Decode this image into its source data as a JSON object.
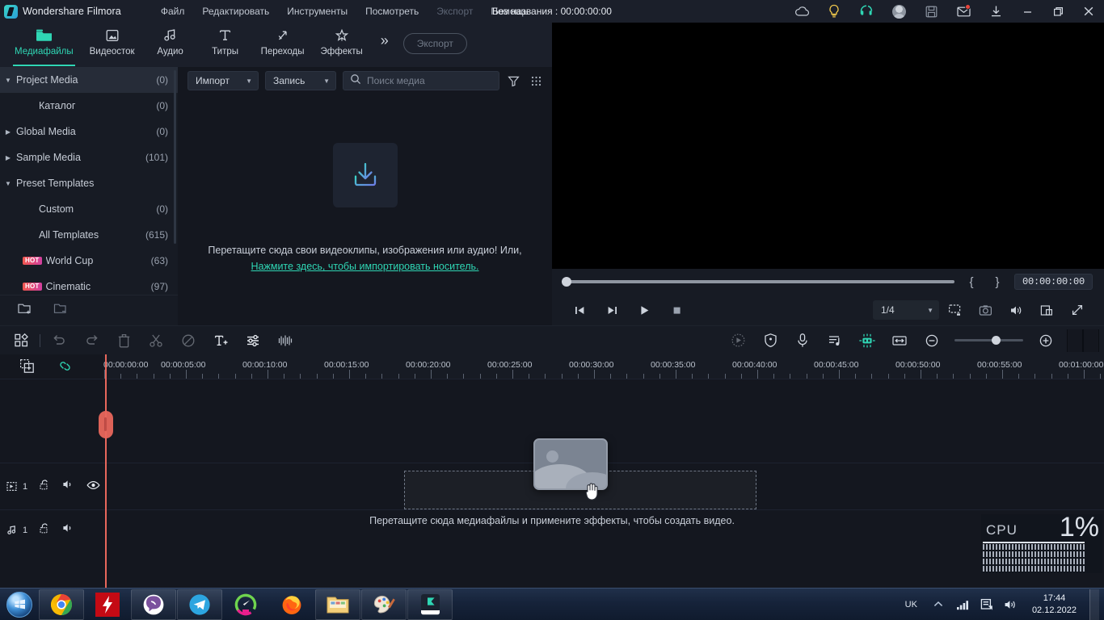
{
  "titlebar": {
    "app_name": "Wondershare Filmora",
    "logo_icon": "filmora-logo-icon",
    "menus": [
      {
        "label": "Файл",
        "dim": false
      },
      {
        "label": "Редактировать",
        "dim": false
      },
      {
        "label": "Инструменты",
        "dim": false
      },
      {
        "label": "Посмотреть",
        "dim": false
      },
      {
        "label": "Экспорт",
        "dim": true
      },
      {
        "label": "Помощь",
        "dim": false
      }
    ],
    "project_title": "Без названия : 00:00:00:00",
    "right_icons": [
      {
        "name": "cloud-icon"
      },
      {
        "name": "lightbulb-icon"
      },
      {
        "name": "headset-support-icon"
      },
      {
        "name": "account-avatar"
      },
      {
        "name": "save-icon"
      },
      {
        "name": "mail-icon",
        "badge": true
      },
      {
        "name": "download-icon"
      }
    ],
    "window_controls": [
      {
        "name": "minimize-button"
      },
      {
        "name": "maximize-button"
      },
      {
        "name": "close-button"
      }
    ]
  },
  "navtabs": {
    "items": [
      {
        "label": "Медиафайлы",
        "icon": "folder-media-icon",
        "active": true
      },
      {
        "label": "Видеосток",
        "icon": "stock-video-icon",
        "active": false
      },
      {
        "label": "Аудио",
        "icon": "audio-note-icon",
        "active": false
      },
      {
        "label": "Титры",
        "icon": "title-text-icon",
        "active": false
      },
      {
        "label": "Переходы",
        "icon": "transitions-icon",
        "active": false
      },
      {
        "label": "Эффекты",
        "icon": "effects-star-icon",
        "active": false
      }
    ],
    "more_icon": "chevron-double-right-icon",
    "export_label": "Экспорт"
  },
  "sidebar": {
    "items": [
      {
        "label": "Project Media",
        "count": "(0)",
        "indent": 0,
        "arrow": "down",
        "selected": true,
        "hot": false
      },
      {
        "label": "Каталог",
        "count": "(0)",
        "indent": 1,
        "arrow": "",
        "selected": false,
        "hot": false
      },
      {
        "label": "Global Media",
        "count": "(0)",
        "indent": 0,
        "arrow": "right",
        "selected": false,
        "hot": false
      },
      {
        "label": "Sample Media",
        "count": "(101)",
        "indent": 0,
        "arrow": "right",
        "selected": false,
        "hot": false
      },
      {
        "label": "Preset Templates",
        "count": "",
        "indent": 0,
        "arrow": "down",
        "selected": false,
        "hot": false
      },
      {
        "label": "Custom",
        "count": "(0)",
        "indent": 1,
        "arrow": "",
        "selected": false,
        "hot": false
      },
      {
        "label": "All Templates",
        "count": "(615)",
        "indent": 1,
        "arrow": "",
        "selected": false,
        "hot": false
      },
      {
        "label": "World Cup",
        "count": "(63)",
        "indent": 1,
        "arrow": "",
        "selected": false,
        "hot": true,
        "hot_label": "HOT"
      },
      {
        "label": "Cinematic",
        "count": "(97)",
        "indent": 1,
        "arrow": "",
        "selected": false,
        "hot": true,
        "hot_label": "HOT"
      }
    ],
    "footer_icons": [
      {
        "name": "add-folder-icon"
      },
      {
        "name": "remove-folder-icon"
      }
    ],
    "collapse_icon": "collapse-panel-icon"
  },
  "media": {
    "import_label": "Импорт",
    "record_label": "Запись",
    "search_placeholder": "Поиск медиа",
    "search_value": "",
    "search_icon": "search-icon",
    "filter_icon": "filter-icon",
    "grid_icon": "grid-view-icon",
    "drop_icon": "import-download-icon",
    "drop_text": "Перетащите сюда свои видеоклипы, изображения или аудио! Или,",
    "drop_link": "Нажмите здесь, чтобы импортировать носитель."
  },
  "player": {
    "timecode": "00:00:00:00",
    "mark_in_icon": "mark-in-brace",
    "mark_out_icon": "mark-out-brace",
    "mark_in": "{",
    "mark_out": "}",
    "controls": [
      {
        "name": "prev-frame-button",
        "icon": "step-back-icon"
      },
      {
        "name": "next-frame-button",
        "icon": "step-forward-icon"
      },
      {
        "name": "play-button",
        "icon": "play-icon"
      },
      {
        "name": "stop-button",
        "icon": "stop-icon"
      }
    ],
    "quality_value": "1/4",
    "right_controls": [
      {
        "name": "screen-mode-button",
        "icon": "monitor-icon"
      },
      {
        "name": "snapshot-button",
        "icon": "camera-icon"
      },
      {
        "name": "volume-button",
        "icon": "speaker-icon"
      },
      {
        "name": "pop-out-button",
        "icon": "popout-icon"
      },
      {
        "name": "fullscreen-button",
        "icon": "fullscreen-icon"
      }
    ]
  },
  "timeline_toolbar": {
    "left_tools": [
      {
        "name": "layouts-button",
        "icon": "grid-squares-icon",
        "dim": false
      },
      {
        "name": "split-button",
        "icon": "split-icon",
        "dim": true
      },
      {
        "name": "undo-button",
        "icon": "undo-icon",
        "dim": true
      },
      {
        "name": "redo-button",
        "icon": "redo-icon",
        "dim": true
      },
      {
        "name": "delete-button",
        "icon": "trash-icon",
        "dim": true
      },
      {
        "name": "crop-button",
        "icon": "scissors-icon",
        "dim": true
      },
      {
        "name": "disable-button",
        "icon": "no-entry-icon",
        "dim": true
      },
      {
        "name": "add-text-button",
        "icon": "text-plus-icon",
        "dim": false
      },
      {
        "name": "adjust-button",
        "icon": "sliders-icon",
        "dim": false
      },
      {
        "name": "audio-waveform-button",
        "icon": "waveform-icon",
        "dim": false
      }
    ],
    "right_tools": [
      {
        "name": "speed-button",
        "icon": "speed-icon",
        "dim": true
      },
      {
        "name": "marker-button",
        "icon": "shield-marker-icon",
        "dim": false
      },
      {
        "name": "voiceover-button",
        "icon": "microphone-icon",
        "dim": false
      },
      {
        "name": "audio-mixer-button",
        "icon": "audio-mixer-icon",
        "dim": false
      },
      {
        "name": "render-preview-button",
        "icon": "render-preview-icon",
        "dim": false,
        "active": true
      },
      {
        "name": "fit-timeline-button",
        "icon": "fit-width-icon",
        "dim": false
      },
      {
        "name": "zoom-out-button",
        "icon": "minus-circle-icon",
        "dim": false
      },
      {
        "name": "zoom-in-button",
        "icon": "plus-circle-icon",
        "dim": false
      }
    ],
    "zoom_slider_name": "timeline-zoom-slider"
  },
  "timeline": {
    "head_icons": [
      {
        "name": "add-track-icon"
      },
      {
        "name": "link-clips-icon"
      }
    ],
    "ruler_labels": [
      "00:00:00:00",
      "00:00:05:00",
      "00:00:10:00",
      "00:00:15:00",
      "00:00:20:00",
      "00:00:25:00",
      "00:00:30:00",
      "00:00:35:00",
      "00:00:40:00",
      "00:00:45:00",
      "00:00:50:00",
      "00:00:55:00",
      "00:01:00:00"
    ],
    "tracks": [
      {
        "type": "video",
        "number": "1",
        "icons": [
          {
            "name": "video-track-icon"
          },
          {
            "name": "lock-track-icon"
          },
          {
            "name": "mute-track-icon"
          },
          {
            "name": "hide-track-icon"
          }
        ]
      },
      {
        "type": "audio",
        "number": "1",
        "icons": [
          {
            "name": "audio-track-icon"
          },
          {
            "name": "lock-track-icon"
          },
          {
            "name": "mute-track-icon"
          }
        ]
      }
    ],
    "hint_text": "Перетащите сюда медиафайлы и примените эффекты, чтобы создать видео.",
    "drag_thumb_name": "dragged-media-thumbnail",
    "cursor_name": "grab-hand-cursor",
    "playhead_name": "playhead"
  },
  "cpu": {
    "label": "CPU",
    "percent": "1%"
  },
  "taskbar": {
    "start_name": "start-button",
    "apps": [
      {
        "name": "taskbar-chrome"
      },
      {
        "name": "taskbar-idm"
      },
      {
        "name": "taskbar-viber"
      },
      {
        "name": "taskbar-telegram"
      },
      {
        "name": "taskbar-speedtest"
      },
      {
        "name": "taskbar-firefox"
      },
      {
        "name": "taskbar-explorer"
      },
      {
        "name": "taskbar-paint"
      },
      {
        "name": "taskbar-filmora"
      }
    ],
    "tray": {
      "language": "UK",
      "icons": [
        {
          "name": "show-hidden-icons"
        },
        {
          "name": "network-signal-icon"
        },
        {
          "name": "action-center-icon"
        },
        {
          "name": "volume-icon"
        }
      ],
      "time": "17:44",
      "date": "02.12.2022"
    }
  },
  "colors": {
    "accent": "#2fd6b4",
    "panel": "#171b24",
    "background": "#14171f",
    "playhead": "#e8675c",
    "hot_badge": "#f0574e"
  }
}
